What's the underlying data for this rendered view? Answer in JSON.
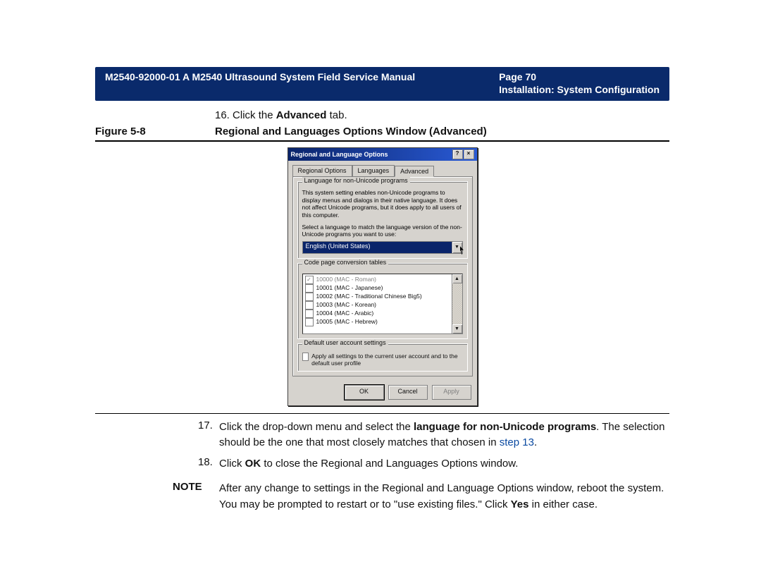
{
  "header": {
    "doc_title": "M2540-92000-01 A M2540 Ultrasound System Field Service Manual",
    "page_label": "Page 70",
    "subtitle": "Installation: System Configuration"
  },
  "step16": {
    "num": "16.",
    "pre": "Click the ",
    "bold": "Advanced",
    "post": " tab."
  },
  "figure": {
    "label": "Figure 5-8",
    "title": "Regional and Languages Options Window (Advanced)"
  },
  "dialog": {
    "title": "Regional and Language Options",
    "help_btn": "?",
    "close_btn": "×",
    "tabs": {
      "regional": "Regional Options",
      "languages": "Languages",
      "advanced": "Advanced"
    },
    "group1": {
      "legend": "Language for non-Unicode programs",
      "desc1": "This system setting enables non-Unicode programs to display menus and dialogs in their native language. It does not affect Unicode programs, but it does apply to all users of this computer.",
      "desc2": "Select a language to match the language version of the non-Unicode programs you want to use:",
      "selected": "English (United States)"
    },
    "group2": {
      "legend": "Code page conversion tables",
      "items": [
        {
          "checked": true,
          "disabled": true,
          "label": "10000 (MAC - Roman)"
        },
        {
          "checked": false,
          "disabled": false,
          "label": "10001 (MAC - Japanese)"
        },
        {
          "checked": false,
          "disabled": false,
          "label": "10002 (MAC - Traditional Chinese Big5)"
        },
        {
          "checked": false,
          "disabled": false,
          "label": "10003 (MAC - Korean)"
        },
        {
          "checked": false,
          "disabled": false,
          "label": "10004 (MAC - Arabic)"
        },
        {
          "checked": false,
          "disabled": false,
          "label": "10005 (MAC - Hebrew)"
        }
      ]
    },
    "group3": {
      "legend": "Default user account settings",
      "checkbox_label": "Apply all settings to the current user account and to the default user profile"
    },
    "buttons": {
      "ok": "OK",
      "cancel": "Cancel",
      "apply": "Apply"
    }
  },
  "step17": {
    "num": "17.",
    "t1": "Click the drop-down menu and select the ",
    "b1": "language for non-Unicode programs",
    "t2": ". The selection should be the one that most closely matches that chosen in ",
    "link": "step 13",
    "t3": "."
  },
  "step18": {
    "num": "18.",
    "t1": "Click ",
    "b1": "OK",
    "t2": " to close the Regional and Languages Options window."
  },
  "note": {
    "label": "NOTE",
    "t1": "After any change to settings in the Regional and Language Options window, reboot the system. You may be prompted to restart or to \"use existing files.\" Click ",
    "b1": "Yes",
    "t2": " in either case."
  }
}
